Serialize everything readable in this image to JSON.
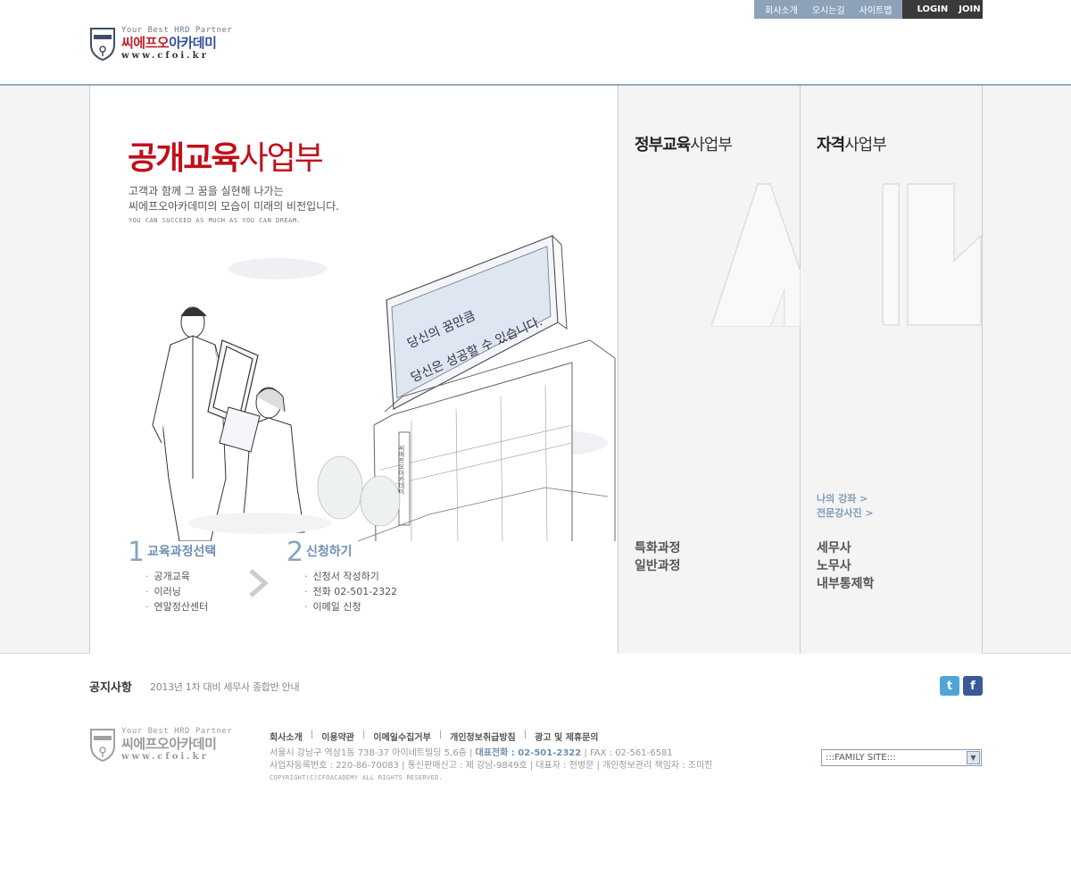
{
  "header": {
    "logo": {
      "tagline": "Your Best HRD Partner",
      "brand_a": "씨에프오",
      "brand_b": "아카데미",
      "url": "www.cfoi.kr",
      "badge": "CFO ACADEMY"
    },
    "util_nav": [
      "회사소개",
      "오시는길",
      "사이트맵"
    ],
    "auth_nav": [
      "LOGIN",
      "JOIN"
    ]
  },
  "public_panel": {
    "title_bold": "공개교육",
    "title_light": "사업부",
    "desc_line1": "고객과 함께 그 꿈을 실현해 나가는",
    "desc_line2": "씨에프오아카데미의 모습이 미래의 비전입니다.",
    "slogan": "YOU CAN SUCCEED AS MUCH AS YOU CAN DREAM.",
    "billboard_line1": "당신의 꿈만큼",
    "billboard_line2": "당신은 성공할 수 있습니다.",
    "building_sign": "씨에프오아카데미",
    "steps": [
      {
        "num": "1",
        "title": "교육과정선택",
        "items": [
          "공개교육",
          "이러닝",
          "연말정산센터"
        ]
      },
      {
        "num": "2",
        "title": "신청하기",
        "items": [
          "신청서 작성하기",
          "전화 02-501-2322",
          "이메일 신청"
        ]
      }
    ]
  },
  "gov_panel": {
    "title_bold": "정부교육",
    "title_light": "사업부",
    "links": [
      "특화과정",
      "일반과정"
    ]
  },
  "cert_panel": {
    "title_bold": "자격",
    "title_light": "사업부",
    "mini_links": [
      "나의 강좌 >",
      "전문강사진 >"
    ],
    "links": [
      "세무사",
      "노무사",
      "내부통제학"
    ]
  },
  "notice": {
    "label": "공지사항",
    "text": "2013년 1차 대비 세무사 종합반 안내"
  },
  "social": {
    "twitter": "t",
    "facebook": "f"
  },
  "footer": {
    "links": [
      "회사소개",
      "이용약관",
      "이메일수집거부",
      "개인정보취급방침",
      "광고 및 제휴문의"
    ],
    "address": "서울시 강남구 역삼1동 738-37 아이네트빌딩 5,6층 |",
    "phone": "대표전화 : 02-501-2322",
    "fax": "| FAX : 02-561-6581",
    "line2": "사업자등록번호 : 220-86-70083 | 통신판매신고 : 제 강남-9849호 | 대표자 : 전병문 | 개인정보관리 책임자 : 조미진",
    "copyright": "COPYRIGHT(C)CFOACADEMY ALL RIGHTS RESERVED.",
    "family_site": ":::FAMILY SITE:::"
  }
}
